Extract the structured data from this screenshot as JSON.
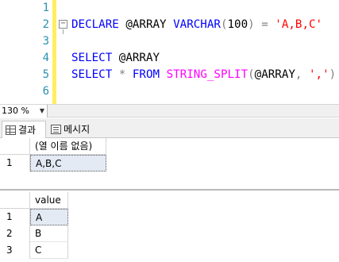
{
  "editor": {
    "line_numbers": [
      "1",
      "2",
      "3",
      "4",
      "5",
      "6"
    ],
    "line2": {
      "kw_declare": "DECLARE",
      "var": "@ARRAY",
      "kw_type": "VARCHAR",
      "paren_open": "(",
      "size": "100",
      "paren_close": ")",
      "eq": "=",
      "str": "'A,B,C'"
    },
    "line4": {
      "kw_select": "SELECT",
      "var": "@ARRAY"
    },
    "line5": {
      "kw_select": "SELECT",
      "star": "*",
      "kw_from": "FROM",
      "fn": "STRING_SPLIT",
      "paren_open": "(",
      "var": "@ARRAY",
      "comma": ",",
      "str": "','",
      "paren_close": ")"
    },
    "fold_glyph": "−"
  },
  "status": {
    "zoom": "130 %",
    "caret": "▼"
  },
  "tabs": [
    {
      "label": "결과",
      "icon": "grid-icon"
    },
    {
      "label": "메시지",
      "icon": "message-icon"
    }
  ],
  "result1": {
    "header": "(열 이름 없음)",
    "rows": [
      {
        "no": "1",
        "value": "A,B,C"
      }
    ]
  },
  "result2": {
    "header": "value",
    "rows": [
      {
        "no": "1",
        "value": "A"
      },
      {
        "no": "2",
        "value": "B"
      },
      {
        "no": "3",
        "value": "C"
      }
    ]
  },
  "colors": {
    "keyword": "#0000ff",
    "string": "#ff0000",
    "function": "#ff00ff",
    "line_number": "#2b91af",
    "margin_bar": "#ffee62",
    "selection": "#e3eaf4"
  }
}
